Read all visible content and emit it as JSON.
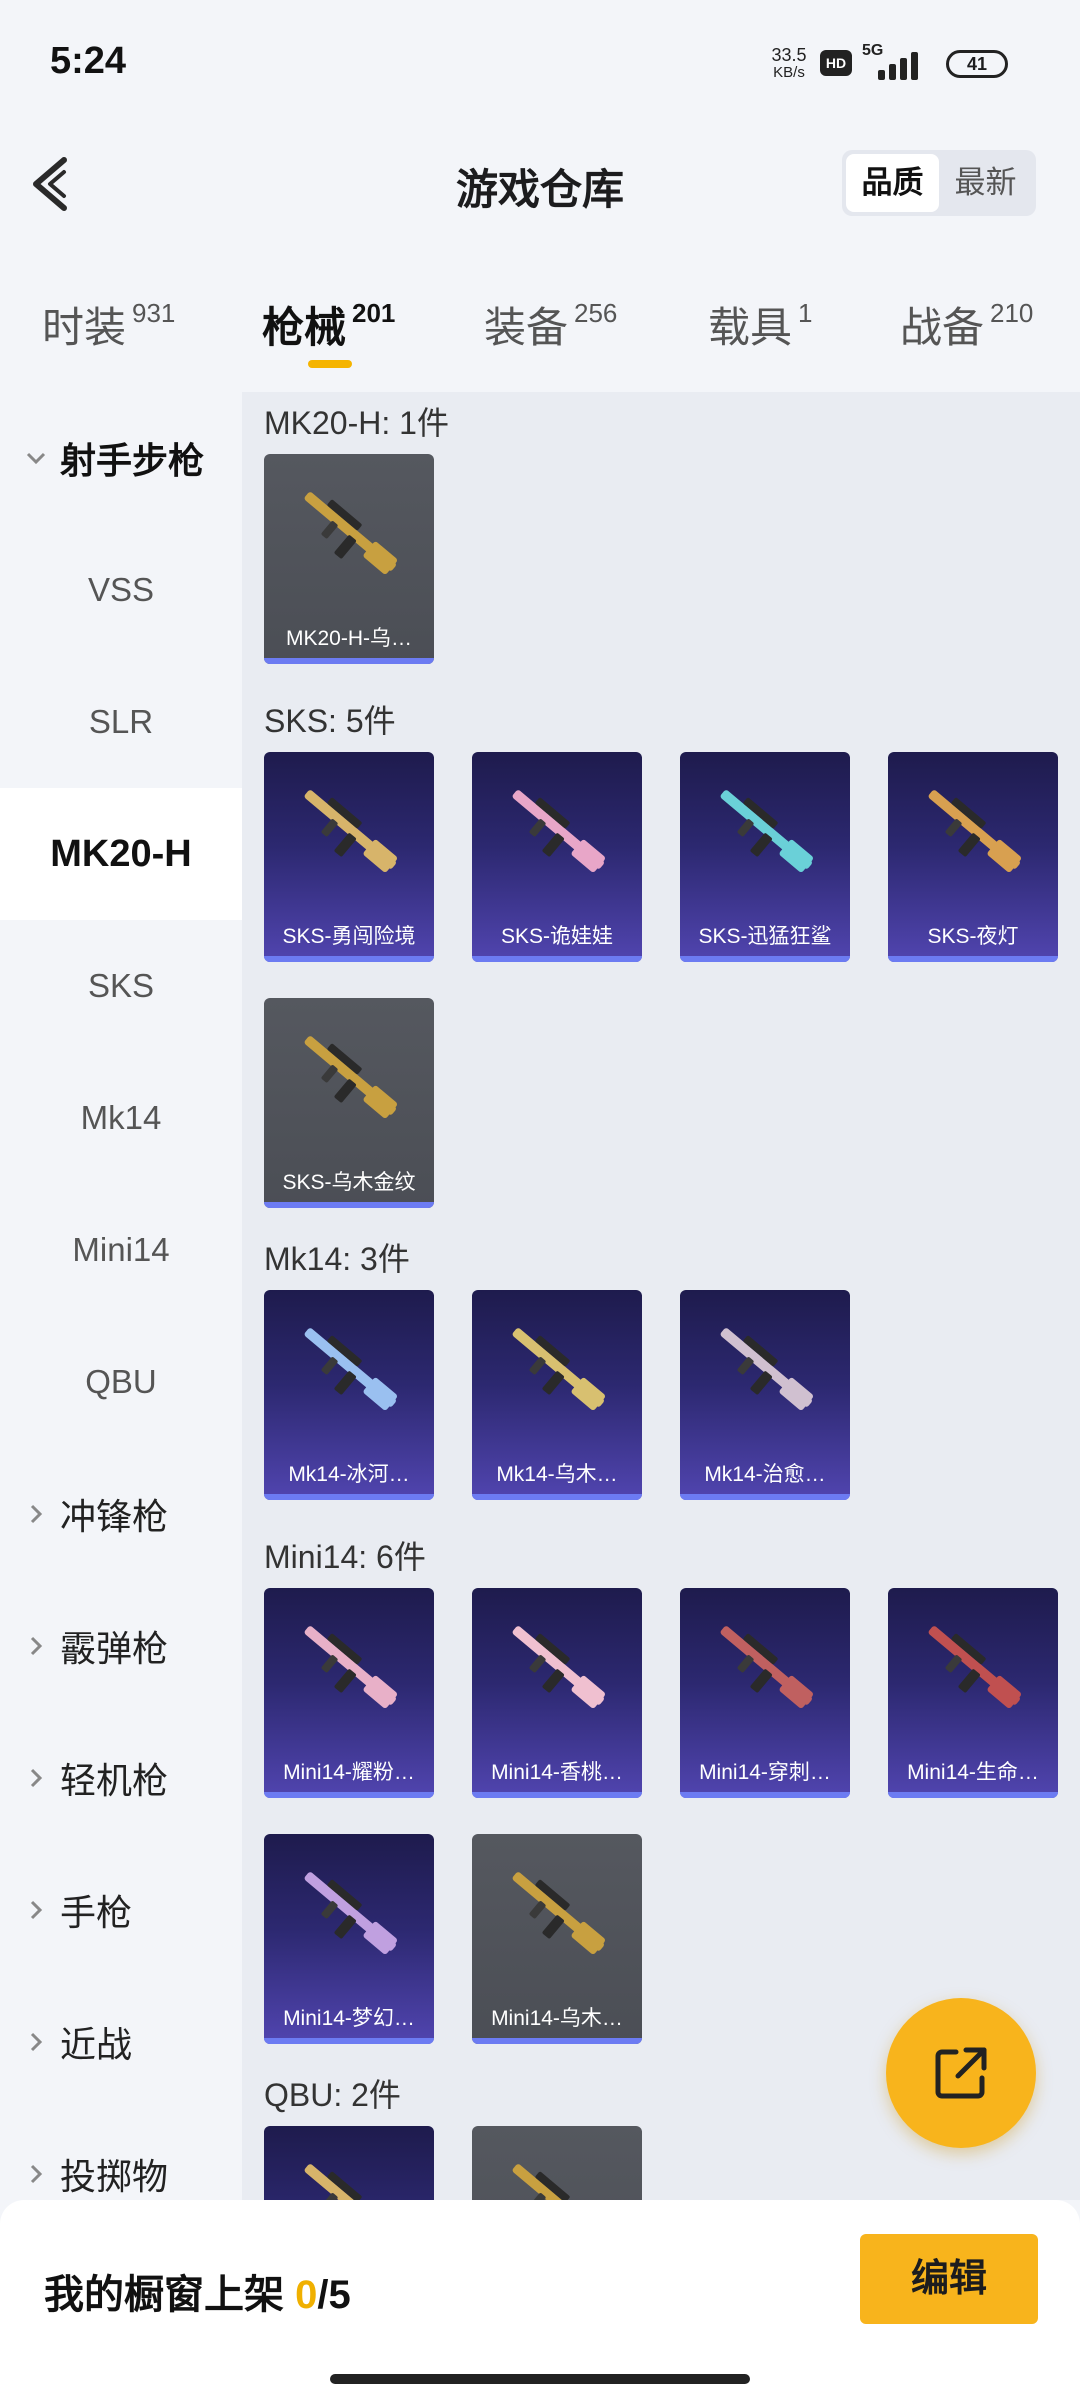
{
  "status_bar": {
    "time": "5:24",
    "speed_value": "33.5",
    "speed_unit": "KB/s",
    "hd": "HD",
    "network": "5G",
    "battery": "41"
  },
  "header": {
    "title": "游戏仓库",
    "sort_options": [
      "品质",
      "最新"
    ],
    "sort_selected": "品质"
  },
  "tabs": [
    {
      "label": "时装",
      "count": "931",
      "active": false
    },
    {
      "label": "枪械",
      "count": "201",
      "active": true
    },
    {
      "label": "装备",
      "count": "256",
      "active": false
    },
    {
      "label": "载具",
      "count": "1",
      "active": false
    },
    {
      "label": "战备",
      "count": "210",
      "active": false
    }
  ],
  "sidebar": {
    "group_open": "射手步枪",
    "sub_items": [
      "VSS",
      "SLR",
      "MK20-H",
      "SKS",
      "Mk14",
      "Mini14",
      "QBU"
    ],
    "selected": "MK20-H",
    "groups": [
      "冲锋枪",
      "霰弹枪",
      "轻机枪",
      "手枪",
      "近战",
      "投掷物"
    ]
  },
  "sections": [
    {
      "title": "MK20-H: 1件",
      "items": [
        {
          "label": "MK20-H-乌…",
          "tier": "gray"
        }
      ]
    },
    {
      "title": "SKS: 5件",
      "items": [
        {
          "label": "SKS-勇闯险境",
          "tier": "purple"
        },
        {
          "label": "SKS-诡娃娃",
          "tier": "purple"
        },
        {
          "label": "SKS-迅猛狂鲨",
          "tier": "purple"
        },
        {
          "label": "SKS-夜灯",
          "tier": "purple"
        },
        {
          "label": "SKS-乌木金纹",
          "tier": "gray"
        }
      ]
    },
    {
      "title": "Mk14: 3件",
      "items": [
        {
          "label": "Mk14-冰河…",
          "tier": "purple"
        },
        {
          "label": "Mk14-乌木…",
          "tier": "purple"
        },
        {
          "label": "Mk14-治愈…",
          "tier": "purple"
        }
      ]
    },
    {
      "title": "Mini14: 6件",
      "items": [
        {
          "label": "Mini14-耀粉…",
          "tier": "purple"
        },
        {
          "label": "Mini14-香桃…",
          "tier": "purple"
        },
        {
          "label": "Mini14-穿刺…",
          "tier": "purple"
        },
        {
          "label": "Mini14-生命…",
          "tier": "purple"
        },
        {
          "label": "Mini14-梦幻…",
          "tier": "purple"
        },
        {
          "label": "Mini14-乌木…",
          "tier": "gray"
        }
      ]
    },
    {
      "title": "QBU: 2件",
      "items": [
        {
          "label": "",
          "tier": "purple"
        },
        {
          "label": "",
          "tier": "gray"
        }
      ]
    }
  ],
  "bottom_bar": {
    "label": "我的橱窗上架",
    "current": "0",
    "sep_total": "/5",
    "edit_label": "编辑"
  },
  "colors": {
    "accent": "#f8b41c",
    "purple_tier": "#2c2870",
    "gray_tier": "#4b4e55",
    "tier_bar": "#6c7bf2"
  }
}
